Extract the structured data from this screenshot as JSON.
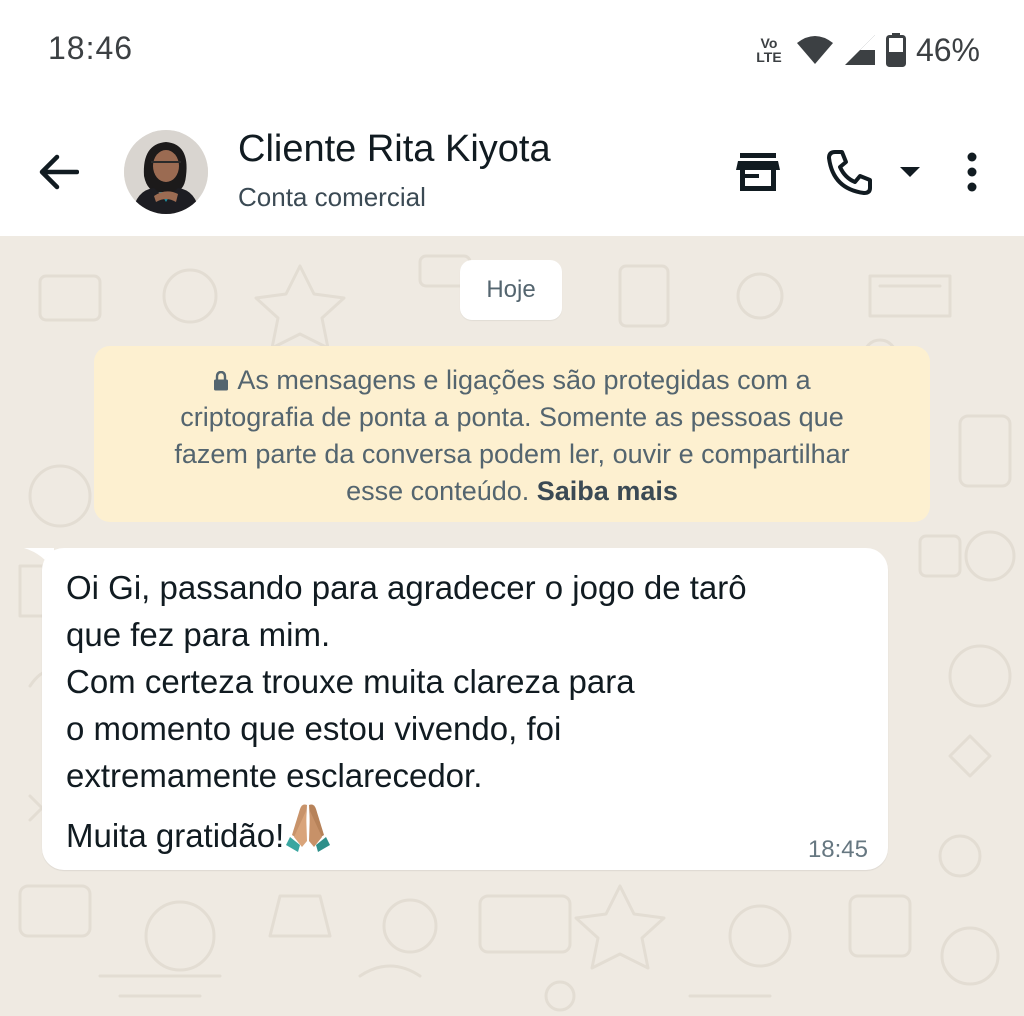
{
  "status_bar": {
    "time": "18:46",
    "network_label_top": "Vo",
    "network_label_bottom": "LTE",
    "battery_percent": "46%",
    "battery_level": 0.46,
    "icons": [
      "volte-icon",
      "wifi-icon",
      "cell-signal-icon",
      "battery-icon"
    ]
  },
  "header": {
    "contact_name": "Cliente Rita Kiyota",
    "subtitle": "Conta comercial",
    "icons": [
      "back-arrow-icon",
      "store-icon",
      "phone-icon",
      "caret-down-icon",
      "more-vert-icon"
    ]
  },
  "chat": {
    "date_chip": "Hoje",
    "encryption_notice": {
      "lines": [
        "As mensagens e ligações são protegidas com a",
        "criptografia de ponta a ponta. Somente as pessoas que",
        "fazem parte da conversa podem ler, ouvir e compartilhar"
      ],
      "last_line_text": "esse conteúdo.",
      "learn_more": "Saiba mais"
    },
    "message": {
      "lines": [
        "Oi Gi, passando para agradecer o jogo de tarô",
        "que fez para mim.",
        "Com certeza trouxe muita clareza para",
        "o momento que estou vivendo, foi",
        "extremamente esclarecedor."
      ],
      "last_line": "Muita gratidão!",
      "emoji": "folded-hands-icon",
      "time": "18:45"
    }
  },
  "colors": {
    "chat_background": "#efeae2",
    "encryption_background": "#fdf0d0",
    "bubble_background": "#ffffff"
  }
}
